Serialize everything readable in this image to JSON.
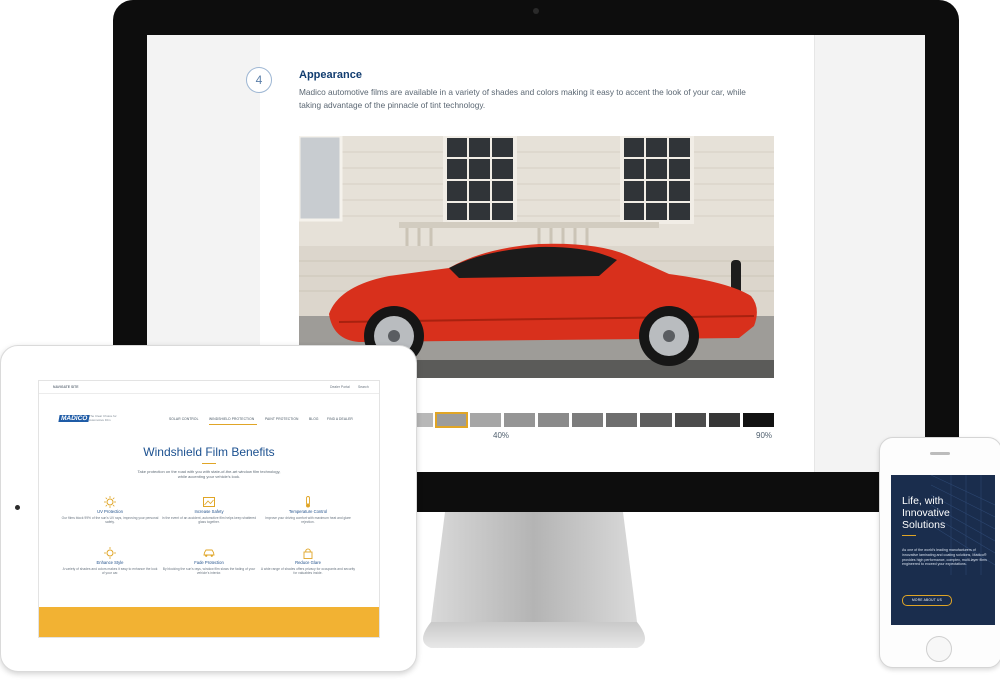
{
  "imac": {
    "step_number": "4",
    "section_title": "Appearance",
    "section_body": "Madico automotive films are available in a variety of shades and colors making it easy to accent the look of your car, while taking advantage of the pinnacle of tint technology.",
    "shades": [
      "#d9d9d9",
      "#cfcfcf",
      "#c4c4c4",
      "#b8b8b8",
      "#9c9c9c",
      "#a6a6a6",
      "#959595",
      "#8a8a8a",
      "#7c7c7c",
      "#6e6e6e",
      "#5e5e5e",
      "#4c4c4c",
      "#363636",
      "#121212"
    ],
    "selected_shade_index": 4,
    "shade_label_left": "40%",
    "shade_label_right": "90%"
  },
  "ipad": {
    "topbar_left": "NAVIGATE SITE",
    "topbar_dealer": "Dealer Portal",
    "topbar_search": "Search",
    "logo": "MADICO",
    "tagline": "The Clear Choice for Automotive Film",
    "nav": [
      "SOLAR CONTROL",
      "WINDSHIELD PROTECTION",
      "PAINT PROTECTION",
      "BLOG",
      "FIND A DEALER"
    ],
    "page_title": "Windshield Film Benefits",
    "intro": "Take protection on the road with you with state-of-the-art window film technology, while accenting your vehicle's look.",
    "benefits": [
      {
        "title": "UV Protection",
        "desc": "Our films block 99% of the sun's UV rays, improving your personal safety.",
        "icon": "sun-icon"
      },
      {
        "title": "Increase Safety",
        "desc": "In the event of an accident, automotive film helps keep shattered glass together.",
        "icon": "image-icon"
      },
      {
        "title": "Temperature Control",
        "desc": "Improve your driving comfort with maximum heat and glare rejection.",
        "icon": "thermometer-icon"
      },
      {
        "title": "Enhance Style",
        "desc": "A variety of shades and colors makes it easy to enhance the look of your car.",
        "icon": "sun-icon"
      },
      {
        "title": "Fade Protection",
        "desc": "By blocking the sun's rays, window film slows the fading of your vehicle's interior.",
        "icon": "car-icon"
      },
      {
        "title": "Reduce Glare",
        "desc": "A wide range of shades offers privacy for occupants and security for valuables inside.",
        "icon": "lock-icon"
      }
    ],
    "accent": "#f2b233"
  },
  "iphone": {
    "headline": "Life, with Innovative Solutions",
    "body": "As one of the world's leading manufacturers of innovative laminating and coating solutions, Madico® provides high performance, complex, multi-layer films engineered to exceed your expectations.",
    "button": "MORE ABOUT US",
    "bg": "#1a2d4d"
  }
}
